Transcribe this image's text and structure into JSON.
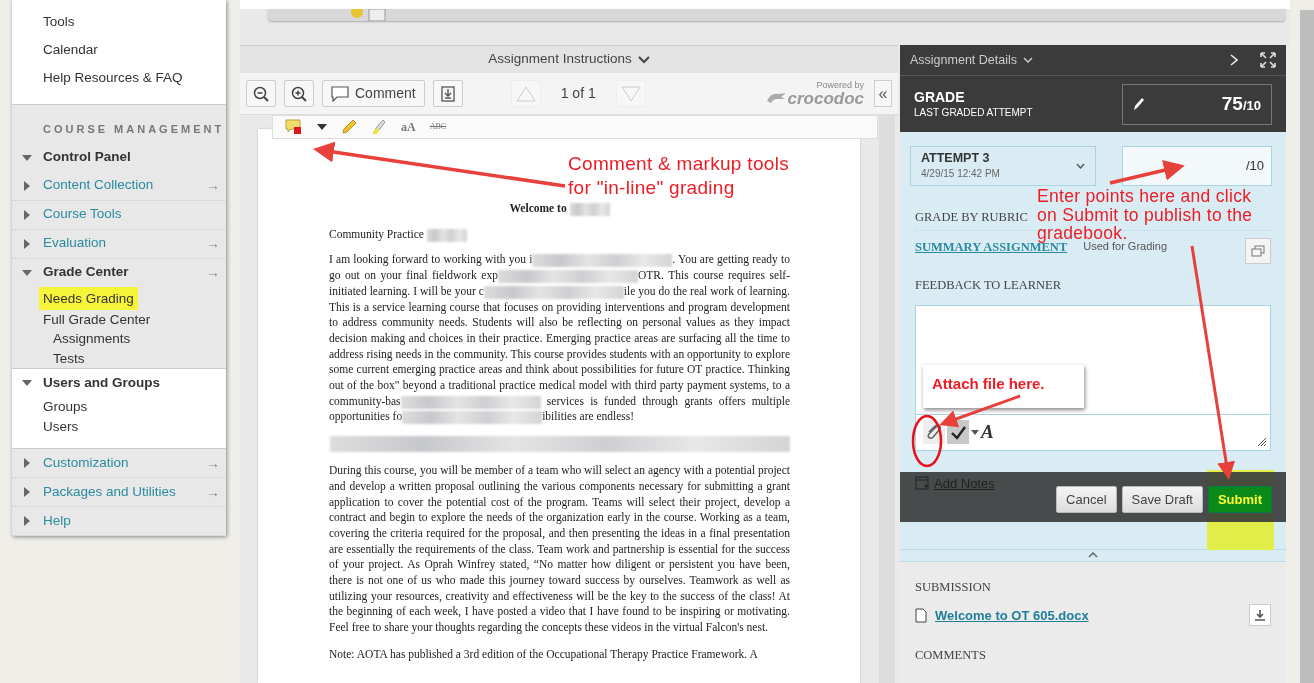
{
  "sidebar": {
    "links": [
      "Tools",
      "Calendar",
      "Help Resources & FAQ"
    ],
    "section_title": "COURSE MANAGEMENT",
    "menu": [
      {
        "label": "Control Panel",
        "expanded": true,
        "children": [
          {
            "label": "Content Collection",
            "expanded": false,
            "arrow": "→"
          },
          {
            "label": "Course Tools",
            "expanded": false
          },
          {
            "label": "Evaluation",
            "expanded": false,
            "arrow": "→"
          },
          {
            "label": "Grade Center",
            "expanded": true,
            "arrow": "→",
            "children": [
              {
                "label": "Needs Grading",
                "highlighted": true
              },
              {
                "label": "Full Grade Center",
                "highlighted": false,
                "children": [
                  {
                    "label": "Assignments",
                    "highlighted": false
                  },
                  {
                    "label": "Tests",
                    "highlighted": false
                  }
                ]
              }
            ]
          }
        ]
      },
      {
        "label": "Users and Groups",
        "expanded": true,
        "children": [
          {
            "label": "Groups",
            "highlighted": false
          },
          {
            "label": "Users",
            "highlighted": false
          }
        ]
      },
      {
        "label": "Customization",
        "expanded": false,
        "arrow": "→"
      },
      {
        "label": "Packages and Utilities",
        "expanded": false,
        "arrow": "→"
      },
      {
        "label": "Help",
        "expanded": false
      }
    ]
  },
  "instructions": {
    "title": "Assignment Instructions",
    "toolbar": {
      "comment": "Comment",
      "page": "1 of 1",
      "powered_by": "Powered by",
      "brand": "crocodoc",
      "collapse": "«"
    },
    "markup_tools": [
      {
        "kind": "comment"
      },
      {
        "kind": "dropdown"
      },
      {
        "kind": "pencil"
      },
      {
        "kind": "highlighter"
      },
      {
        "kind": "text",
        "label": "aA"
      },
      {
        "kind": "strike",
        "label": "ABC"
      }
    ],
    "document": {
      "title": [
        {
          "kind": "text",
          "text": "Welcome to"
        },
        {
          "kind": "redaction"
        }
      ],
      "subtitle": [
        {
          "kind": "text",
          "text": "Community Practice"
        },
        {
          "kind": "redaction"
        }
      ],
      "paragraphs": [
        [
          {
            "kind": "text",
            "text": "I am looking forward to working with you i"
          },
          {
            "kind": "redaction"
          },
          {
            "kind": "text",
            "text": ". You are getting ready to go out on your final fieldwork exp"
          },
          {
            "kind": "redaction"
          },
          {
            "kind": "text",
            "text": "OTR. This course requires self-initiated learning. I will be your c"
          },
          {
            "kind": "redaction"
          },
          {
            "kind": "text",
            "text": "ile you do the real work of learning. This is a service learning course that focuses on providing interventions and program development to address community needs. Students will also be reflecting on personal values as they impact decision making and choices in their practice.  Emerging practice areas are surfacing all the time to address rising needs in the community. This course provides students with an opportunity to explore some current emerging practice areas and think about possibilities for future OT practice. Thinking out of the box\" beyond a traditional practice medical model with third party payment systems, to a community-bas"
          },
          {
            "kind": "redaction"
          },
          {
            "kind": "text",
            "text": " services is funded through grants offers multiple opportunities fo"
          },
          {
            "kind": "redaction"
          },
          {
            "kind": "text",
            "text": "ibilities are endless!"
          }
        ],
        [
          {
            "kind": "redacted_line"
          }
        ],
        [
          {
            "kind": "text",
            "text": "During this course, you will be member of a team who will select an agency with a potential project and develop a written proposal outlining the various components necessary for submitting a grant application to cover the potential cost of the program. Teams will select their project, develop a contract and begin to explore the needs of the organization early in the course. Working as a team, covering the criteria required for the proposal, and then presenting the ideas in a final presentation are essentially the requirements of the class. Team work and partnership is essential for the success of your project. As Oprah Winfrey stated, “No matter how diligent or persistent you have been, there is not one of us who made this journey toward success by ourselves.  Teamwork as well as utilizing your resources, creativity and effectiveness will be the key to the success of the class! At the beginning of each week, I have posted a video that I have found to be inspiring or motivating. Feel free to share your thoughts regarding the concepts these videos in the virtual Falcon's nest."
          }
        ],
        [
          {
            "kind": "text",
            "text": "Note: AOTA has published a 3rd edition of the Occupational Therapy Practice Framework. A"
          }
        ]
      ]
    }
  },
  "details": {
    "title": "Assignment Details",
    "grade": {
      "label": "GRADE",
      "sublabel": "LAST GRADED ATTEMPT",
      "score": "75",
      "out_of": "/10"
    },
    "attempt": {
      "label": "ATTEMPT 3",
      "date": "4/29/15 12:42 PM"
    },
    "grade_input": {
      "suffix": "/10"
    },
    "rubric": {
      "heading": "GRADE BY RUBRIC",
      "link": "SUMMARY ASSIGNMENT",
      "note": "Used for Grading"
    },
    "feedback": {
      "heading": "FEEDBACK TO LEARNER",
      "tools": [
        {
          "kind": "attach"
        },
        {
          "kind": "spellcheck"
        },
        {
          "kind": "dropdown"
        },
        {
          "kind": "font",
          "label": "A"
        }
      ]
    },
    "actions": {
      "notes": "Add Notes",
      "buttons": [
        {
          "label": "Cancel",
          "kind": "secondary"
        },
        {
          "label": "Save Draft",
          "kind": "secondary"
        },
        {
          "label": "Submit",
          "kind": "primary"
        }
      ]
    },
    "submission": {
      "heading": "SUBMISSION",
      "file": "Welcome to OT 605.docx",
      "comments_heading": "COMMENTS"
    }
  },
  "annotations": [
    {
      "kind": "caption",
      "lines": [
        "Comment & markup tools",
        "for \"in-line\" grading"
      ]
    },
    {
      "kind": "caption",
      "lines": [
        "Enter points here and click",
        "on Submit to publish to the",
        "gradebook."
      ]
    },
    {
      "kind": "callout",
      "lines": [
        "Attach file here."
      ]
    }
  ]
}
